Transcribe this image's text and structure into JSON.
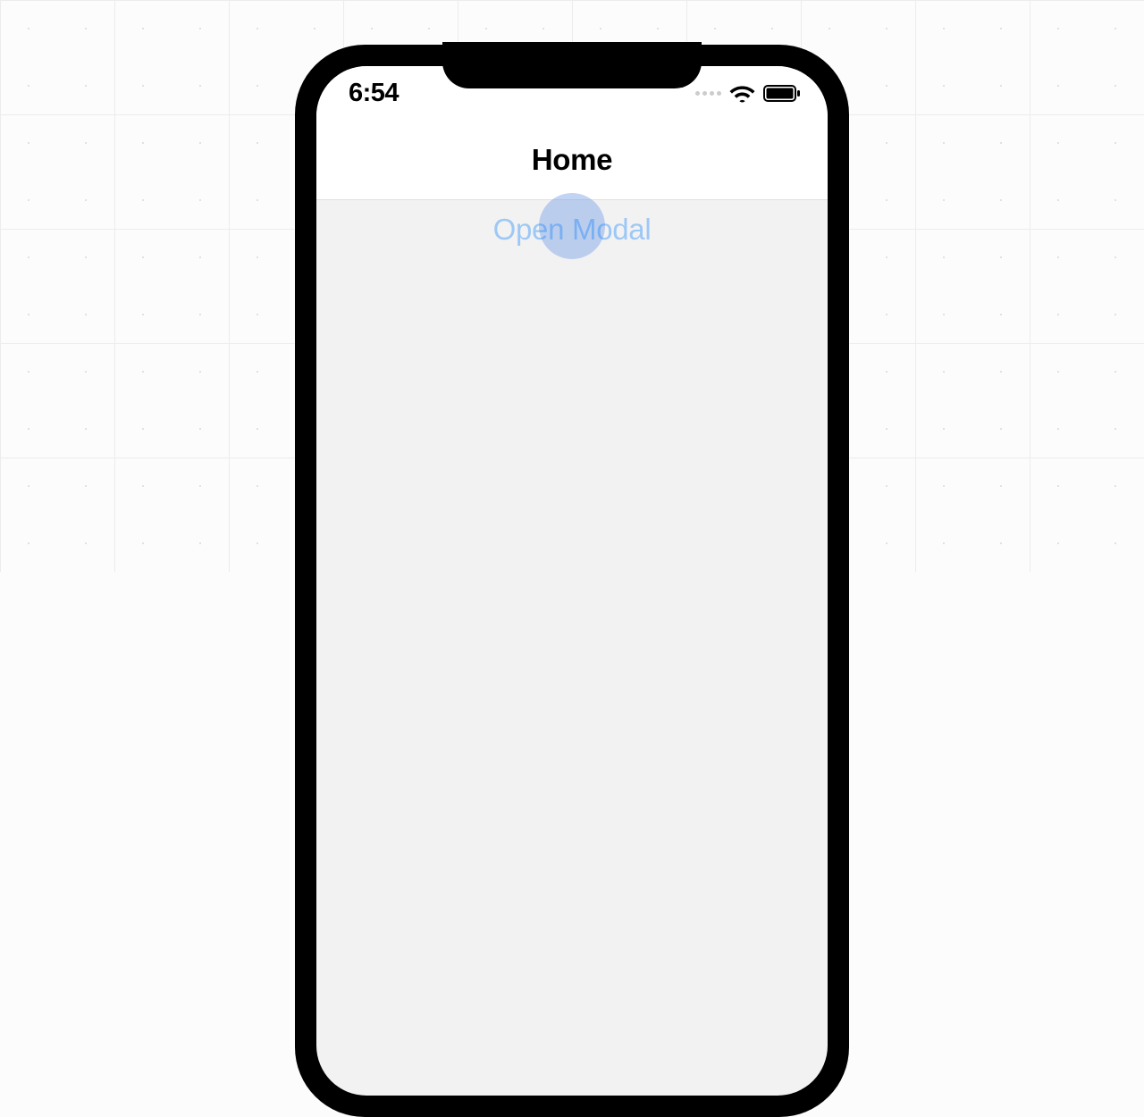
{
  "status_bar": {
    "time": "6:54"
  },
  "nav": {
    "title": "Home"
  },
  "content": {
    "open_modal_label": "Open Modal"
  }
}
